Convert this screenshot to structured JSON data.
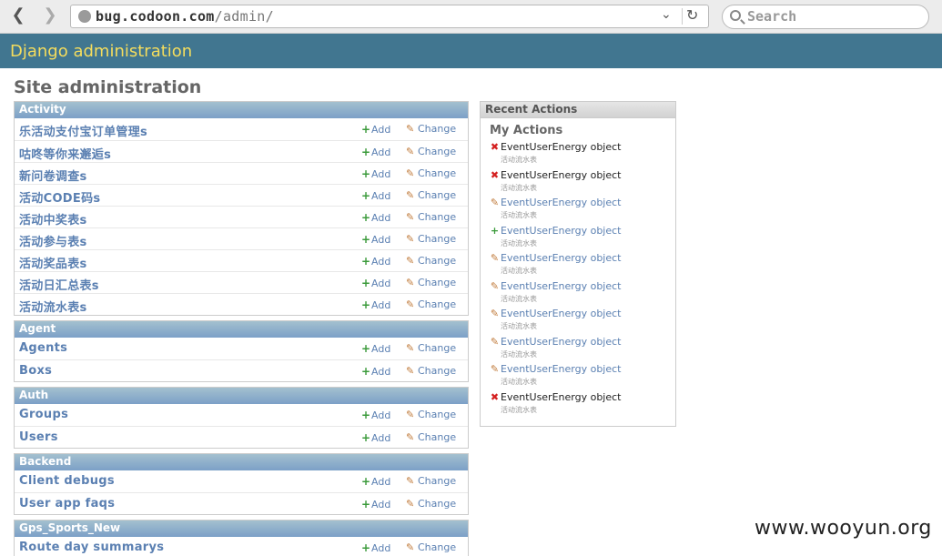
{
  "browser": {
    "url_host": "bug.codoon.com",
    "url_path": "/admin/",
    "search_placeholder": "Search"
  },
  "header": {
    "brand": "Django administration"
  },
  "page_title": "Site administration",
  "modules": [
    {
      "caption": "Activity",
      "rows": [
        {
          "name": "乐活动支付宝订单管理s",
          "add": "Add",
          "change": "Change"
        },
        {
          "name": "咕咚等你来邂逅s",
          "add": "Add",
          "change": "Change"
        },
        {
          "name": "新问卷调查s",
          "add": "Add",
          "change": "Change"
        },
        {
          "name": "活动CODE码s",
          "add": "Add",
          "change": "Change"
        },
        {
          "name": "活动中奖表s",
          "add": "Add",
          "change": "Change"
        },
        {
          "name": "活动参与表s",
          "add": "Add",
          "change": "Change"
        },
        {
          "name": "活动奖品表s",
          "add": "Add",
          "change": "Change"
        },
        {
          "name": "活动日汇总表s",
          "add": "Add",
          "change": "Change"
        },
        {
          "name": "活动流水表s",
          "add": "Add",
          "change": "Change"
        }
      ]
    },
    {
      "caption": "Agent",
      "rows": [
        {
          "name": "Agents",
          "add": "Add",
          "change": "Change"
        },
        {
          "name": "Boxs",
          "add": "Add",
          "change": "Change"
        }
      ]
    },
    {
      "caption": "Auth",
      "rows": [
        {
          "name": "Groups",
          "add": "Add",
          "change": "Change"
        },
        {
          "name": "Users",
          "add": "Add",
          "change": "Change"
        }
      ]
    },
    {
      "caption": "Backend",
      "rows": [
        {
          "name": "Client debugs",
          "add": "Add",
          "change": "Change"
        },
        {
          "name": "User app faqs",
          "add": "Add",
          "change": "Change"
        }
      ]
    },
    {
      "caption": "Gps_Sports_New",
      "rows": [
        {
          "name": "Route day summarys",
          "add": "Add",
          "change": "Change"
        }
      ]
    }
  ],
  "recent": {
    "caption": "Recent Actions",
    "subtitle": "My Actions",
    "items": [
      {
        "kind": "delete",
        "icon": "delete-icon",
        "text": "EventUserEnergy object",
        "sub": "活动流水表"
      },
      {
        "kind": "delete",
        "icon": "delete-icon",
        "text": "EventUserEnergy object",
        "sub": "活动流水表"
      },
      {
        "kind": "change",
        "icon": "pencil-icon",
        "text": "EventUserEnergy object",
        "sub": "活动流水表"
      },
      {
        "kind": "add",
        "icon": "plus-icon",
        "text": "EventUserEnergy object",
        "sub": "活动流水表"
      },
      {
        "kind": "change",
        "icon": "pencil-icon",
        "text": "EventUserEnergy object",
        "sub": "活动流水表"
      },
      {
        "kind": "change",
        "icon": "pencil-icon",
        "text": "EventUserEnergy object",
        "sub": "活动流水表"
      },
      {
        "kind": "change",
        "icon": "pencil-icon",
        "text": "EventUserEnergy object",
        "sub": "活动流水表"
      },
      {
        "kind": "change",
        "icon": "pencil-icon",
        "text": "EventUserEnergy object",
        "sub": "活动流水表"
      },
      {
        "kind": "change",
        "icon": "pencil-icon",
        "text": "EventUserEnergy object",
        "sub": "活动流水表"
      },
      {
        "kind": "delete",
        "icon": "delete-icon",
        "text": "EventUserEnergy object",
        "sub": "活动流水表"
      }
    ]
  },
  "watermark": "www.wooyun.org",
  "colors": {
    "header_bg": "#417690",
    "brand": "#f5dd5d",
    "link": "#5b80b2",
    "caption_bg": "#7ca0c7"
  }
}
